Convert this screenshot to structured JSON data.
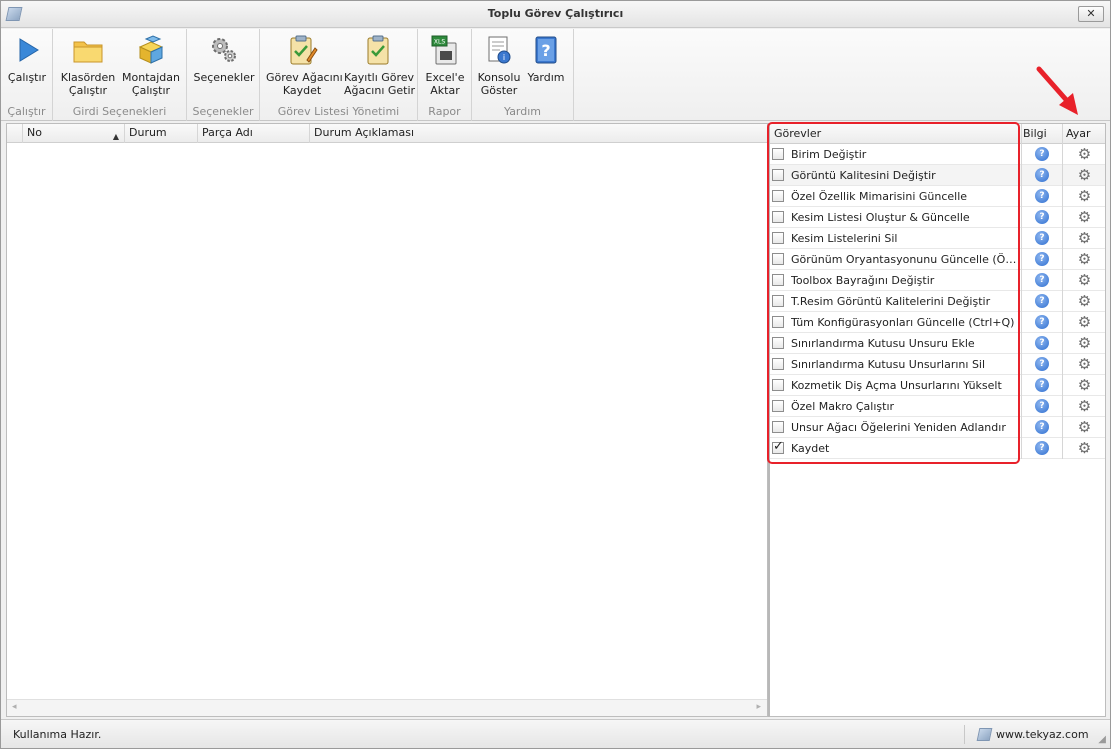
{
  "window": {
    "title": "Toplu Görev Çalıştırıcı",
    "close_glyph": "✕"
  },
  "ribbon": {
    "groups": [
      {
        "label": "Çalıştır",
        "buttons": [
          {
            "label1": "Çalıştır",
            "label2": ""
          }
        ]
      },
      {
        "label": "Girdi Seçenekleri",
        "buttons": [
          {
            "label1": "Klasörden",
            "label2": "Çalıştır"
          },
          {
            "label1": "Montajdan",
            "label2": "Çalıştır"
          }
        ]
      },
      {
        "label": "Seçenekler",
        "buttons": [
          {
            "label1": "Seçenekler",
            "label2": ""
          }
        ]
      },
      {
        "label": "Görev Listesi Yönetimi",
        "buttons": [
          {
            "label1": "Görev Ağacını",
            "label2": "Kaydet"
          },
          {
            "label1": "Kayıtlı Görev",
            "label2": "Ağacını Getir"
          }
        ]
      },
      {
        "label": "Rapor",
        "buttons": [
          {
            "label1": "Excel'e",
            "label2": "Aktar",
            "icon_text": "XLS"
          }
        ]
      },
      {
        "label": "Yardım",
        "buttons": [
          {
            "label1": "Konsolu",
            "label2": "Göster"
          },
          {
            "label1": "Yardım",
            "label2": ""
          }
        ]
      }
    ]
  },
  "results_grid": {
    "columns": [
      "No",
      "Durum",
      "Parça Adı",
      "Durum Açıklaması"
    ],
    "sort_indicator": "▲",
    "rows": [],
    "scroll_left": "◂",
    "scroll_right": "▸"
  },
  "tasks_grid": {
    "columns": {
      "tasks": "Görevler",
      "info": "Bilgi",
      "settings": "Ayar"
    },
    "info_glyph": "?",
    "gear_glyph": "⚙",
    "rows": [
      {
        "label": "Birim Değiştir",
        "checked": false
      },
      {
        "label": "Görüntü Kalitesini Değiştir",
        "checked": false
      },
      {
        "label": "Özel Özellik Mimarisini Güncelle",
        "checked": false
      },
      {
        "label": "Kesim Listesi Oluştur & Güncelle",
        "checked": false
      },
      {
        "label": "Kesim Listelerini Sil",
        "checked": false
      },
      {
        "label": "Görünüm Oryantasyonunu Güncelle (Ön, Sağ...",
        "checked": false
      },
      {
        "label": "Toolbox Bayrağını Değiştir",
        "checked": false
      },
      {
        "label": "T.Resim Görüntü Kalitelerini Değiştir",
        "checked": false
      },
      {
        "label": "Tüm Konfigürasyonları Güncelle (Ctrl+Q)",
        "checked": false
      },
      {
        "label": "Sınırlandırma Kutusu Unsuru Ekle",
        "checked": false
      },
      {
        "label": "Sınırlandırma Kutusu Unsurlarını Sil",
        "checked": false
      },
      {
        "label": "Kozmetik Diş Açma Unsurlarını Yükselt",
        "checked": false
      },
      {
        "label": "Özel Makro Çalıştır",
        "checked": false
      },
      {
        "label": "Unsur Ağacı Öğelerini Yeniden Adlandır",
        "checked": false
      },
      {
        "label": "Kaydet",
        "checked": true
      }
    ]
  },
  "status": {
    "message": "Kullanıma Hazır.",
    "website": "www.tekyaz.com",
    "grip": "◢"
  },
  "colors": {
    "highlight": "#e8212a",
    "accent": "#2f6fd0"
  }
}
